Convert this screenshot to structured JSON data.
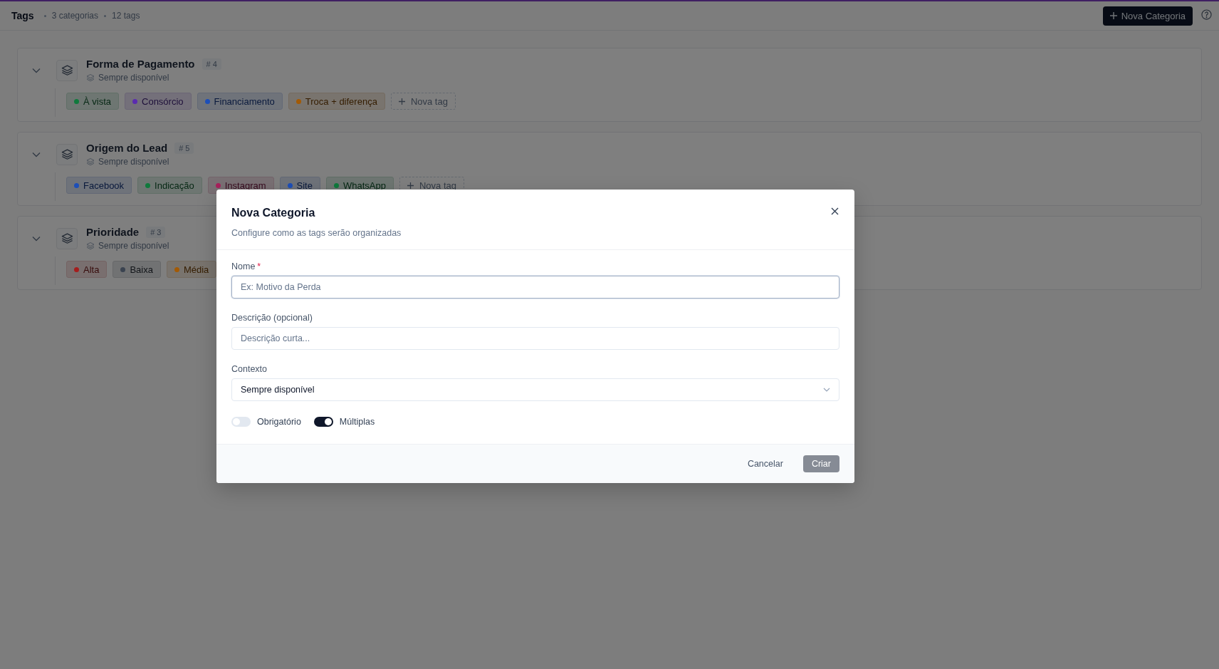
{
  "header": {
    "title": "Tags",
    "stats": [
      "3 categorias",
      "12 tags"
    ],
    "new_button": "Nova Categoria"
  },
  "categories": [
    {
      "name": "Forma de Pagamento",
      "count": "# 4",
      "context": "Sempre disponível",
      "expanded": true,
      "tags": [
        {
          "label": "À vista",
          "color": "#0f7a3c"
        },
        {
          "label": "Consórcio",
          "color": "#5b2bb0"
        },
        {
          "label": "Financiamento",
          "color": "#1d4fb8"
        },
        {
          "label": "Troca + diferença",
          "color": "#a35a05"
        }
      ],
      "add_label": "Nova tag"
    },
    {
      "name": "Origem do Lead",
      "count": "# 5",
      "context": "Sempre disponível",
      "expanded": true,
      "tags": [
        {
          "label": "Facebook",
          "color": "#1d4fb8"
        },
        {
          "label": "Indicação",
          "color": "#0f7a3c"
        },
        {
          "label": "Instagram",
          "color": "#a8215c"
        },
        {
          "label": "Site",
          "color": "#1d4fb8"
        },
        {
          "label": "WhatsApp",
          "color": "#0f7a3c"
        }
      ],
      "add_label": "Nova tag"
    },
    {
      "name": "Prioridade",
      "count": "# 3",
      "context": "Sempre disponível",
      "expanded": true,
      "tags": [
        {
          "label": "Alta",
          "color": "#a51d1d"
        },
        {
          "label": "Baixa",
          "color": "#3a4350"
        },
        {
          "label": "Média",
          "color": "#a35a05"
        }
      ]
    }
  ],
  "dialog": {
    "title": "Nova Categoria",
    "subtitle": "Configure como as tags serão organizadas",
    "fields": [
      {
        "kind": "text",
        "label": "Nome",
        "required_mark": "*",
        "placeholder": "Ex: Motivo da Perda",
        "focused": true
      },
      {
        "kind": "text",
        "label": "Descrição (opcional)",
        "placeholder": "Descrição curta..."
      },
      {
        "kind": "select",
        "label": "Contexto",
        "value": "Sempre disponível"
      }
    ],
    "toggles": [
      {
        "label": "Obrigatório",
        "on": false
      },
      {
        "label": "Múltiplas",
        "on": true
      }
    ],
    "buttons": [
      {
        "label": "Cancelar",
        "kind": "ghost",
        "disabled": false
      },
      {
        "label": "Criar",
        "kind": "primary",
        "disabled": true
      }
    ]
  }
}
